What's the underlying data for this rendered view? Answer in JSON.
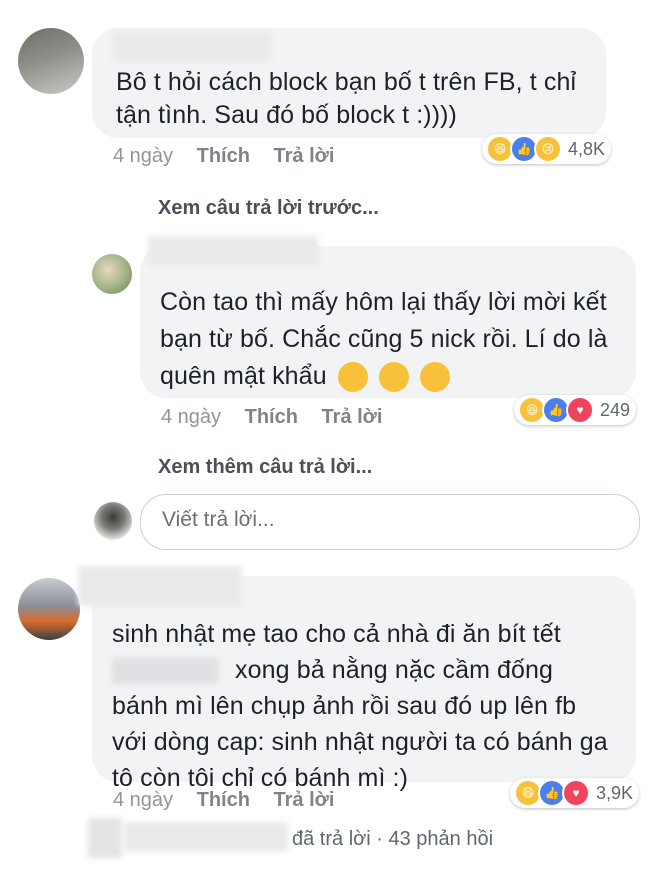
{
  "comments": [
    {
      "text_line1": "Bô t hỏi cách block bạn bố t trên FB, t chỉ",
      "text_line2": "tận tình. Sau đó bố block t :))))",
      "time": "4 ngày",
      "like_label": "Thích",
      "reply_label": "Trả lời",
      "reaction_count": "4,8K",
      "reactions": [
        "haha-icon",
        "like-icon",
        "sad-icon"
      ]
    }
  ],
  "view_previous": "Xem câu trả lời trước...",
  "reply": {
    "text_line1": "Còn tao thì mấy hôm lại thấy lời mời kết",
    "text_line2": "bạn từ bố. Chắc cũng 5 nick rồi. Lí do là",
    "text_line3": "quên mật khẩu",
    "time": "4 ngày",
    "like_label": "Thích",
    "reply_label": "Trả lời",
    "reaction_count": "249",
    "reactions": [
      "haha-icon",
      "like-icon",
      "love-icon"
    ]
  },
  "view_more": "Xem thêm câu trả lời...",
  "reply_input": {
    "placeholder": "Viết trả lời..."
  },
  "comment2": {
    "text_line1": "sinh nhật mẹ tao cho cả nhà đi ăn bít tết",
    "text_line2_tail": "xong bả nằng nặc cầm đống",
    "text_line3": "bánh mì lên chụp ảnh rồi sau đó up lên fb",
    "text_line4": "với dòng cap: sinh nhật người ta có bánh ga",
    "text_line5": "tô còn tôi chỉ có bánh mì :)",
    "time": "4 ngày",
    "like_label": "Thích",
    "reply_label": "Trả lời",
    "reaction_count": "3,9K",
    "reactions": [
      "haha-icon",
      "like-icon",
      "love-icon"
    ]
  },
  "replies_summary": "đã trả lời · 43 phản hồi",
  "colors": {
    "bubble": "#f2f3f5",
    "meta": "#90949c",
    "like": "#4a7ff0",
    "love": "#f0435c",
    "haha": "#f7c23a"
  }
}
